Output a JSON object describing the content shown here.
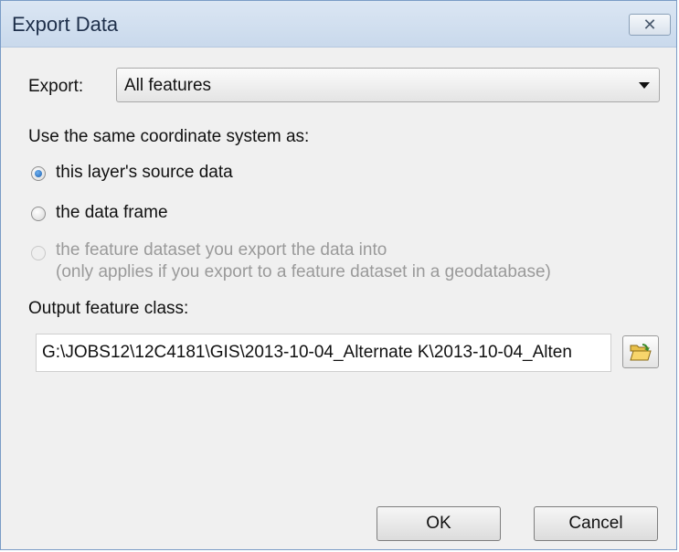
{
  "window": {
    "title": "Export Data",
    "close_glyph": "✕"
  },
  "export": {
    "label": "Export:",
    "selected": "All features"
  },
  "coordinate": {
    "heading": "Use the same coordinate system as:",
    "options": [
      {
        "label": "this layer's source data",
        "checked": true,
        "enabled": true
      },
      {
        "label": "the data frame",
        "checked": false,
        "enabled": true
      },
      {
        "label": "the feature dataset you export the data into",
        "sublabel": "(only applies if you export to a feature dataset in a geodatabase)",
        "checked": false,
        "enabled": false
      }
    ]
  },
  "output": {
    "label": "Output feature class:",
    "value": "G:\\JOBS12\\12C4181\\GIS\\2013-10-04_Alternate K\\2013-10-04_Alten",
    "browse_icon": "folder-open-icon"
  },
  "buttons": {
    "ok": "OK",
    "cancel": "Cancel"
  },
  "colors": {
    "title_bar": "#c9d9ec",
    "dialog_bg": "#f0f0f0",
    "radio_selected": "#1a5fb0"
  }
}
